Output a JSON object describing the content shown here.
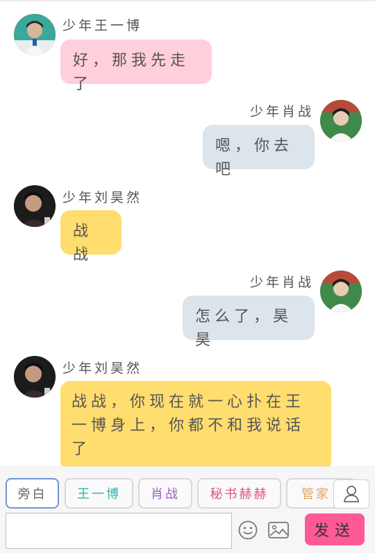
{
  "messages": [
    {
      "side": "left",
      "name": "少年王一博",
      "text": "好，那我先走了",
      "bubble": "pink",
      "avatar": "avatar-wang-yibo"
    },
    {
      "side": "right",
      "name": "少年肖战",
      "text": "嗯，你去吧",
      "bubble": "blue",
      "avatar": "avatar-xiao-zhan"
    },
    {
      "side": "left",
      "name": "少年刘昊然",
      "text": "战战",
      "bubble": "yellow",
      "avatar": "avatar-liu-haoran"
    },
    {
      "side": "right",
      "name": "少年肖战",
      "text": "怎么了，昊昊",
      "bubble": "blue",
      "avatar": "avatar-xiao-zhan"
    },
    {
      "side": "left",
      "name": "少年刘昊然",
      "text": "战战，你现在就一心扑在王一博身上，你都不和我说话了",
      "bubble": "yellow",
      "avatar": "avatar-liu-haoran"
    }
  ],
  "roles": [
    {
      "label": "旁白",
      "color": "#666666"
    },
    {
      "label": "王一博",
      "color": "#2bb7a8"
    },
    {
      "label": "肖战",
      "color": "#a05cc8"
    },
    {
      "label": "秘书赫赫",
      "color": "#e0508a"
    },
    {
      "label": "管家",
      "color": "#e8a05c"
    }
  ],
  "composer": {
    "placeholder": "",
    "send_label": "发送"
  },
  "icons": {
    "emoji": "smiley-face-icon",
    "image": "image-icon",
    "profile": "user-profile-icon"
  },
  "colors": {
    "pink_bubble": "#ffcfdb",
    "blue_bubble": "#dce4ec",
    "yellow_bubble": "#ffdd6e",
    "send": "#ff5a97"
  }
}
